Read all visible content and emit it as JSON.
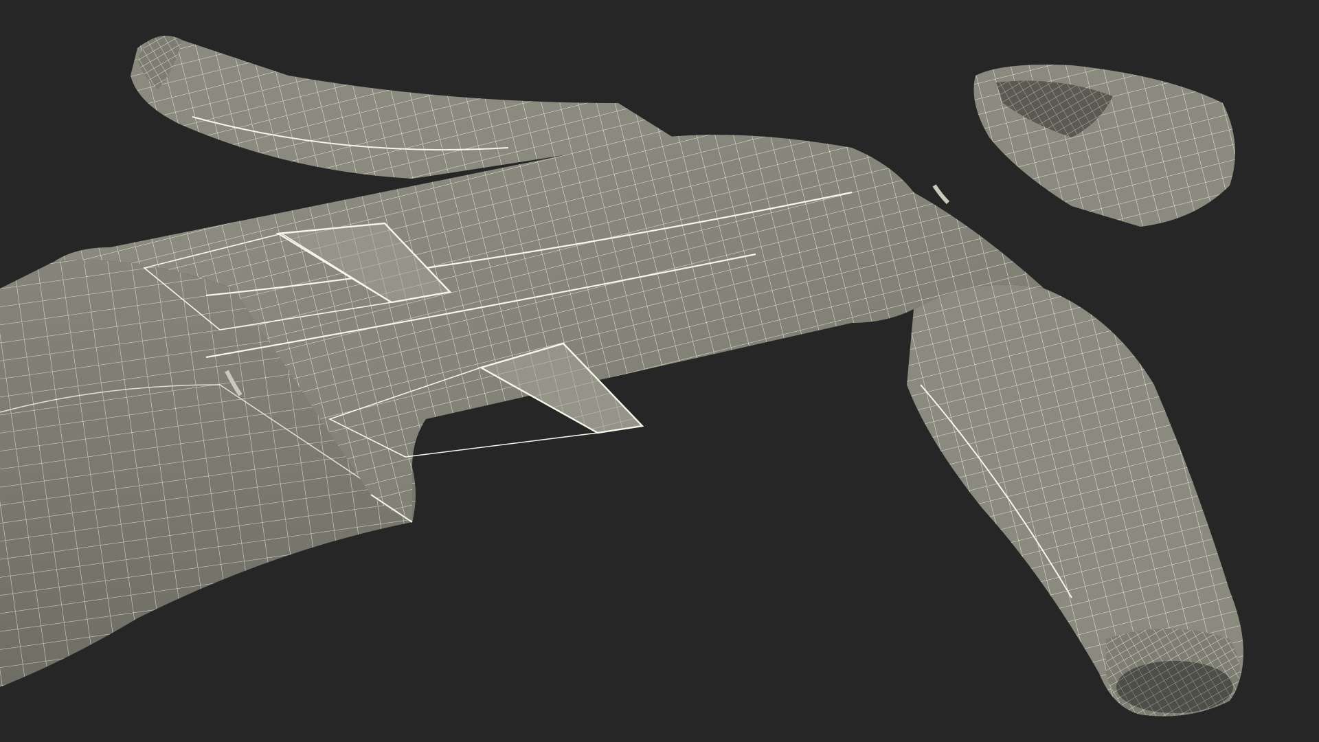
{
  "scene": {
    "subject": "hooded-jacket-wireframe-render",
    "colors": {
      "background": "#262626",
      "surface": "#8a8a7e",
      "surface_shadow": "#6f6f66",
      "surface_light": "#9a9a8e",
      "wire": "#efefe2",
      "seam": "#f6f6ea",
      "inner": "#5a5a53"
    },
    "parts": [
      {
        "id": "left-sleeve",
        "label": ""
      },
      {
        "id": "right-sleeve",
        "label": ""
      },
      {
        "id": "hood",
        "label": ""
      },
      {
        "id": "body",
        "label": ""
      },
      {
        "id": "lower-panel",
        "label": ""
      },
      {
        "id": "pocket-flap-upper",
        "label": ""
      },
      {
        "id": "pocket-flap-lower",
        "label": ""
      },
      {
        "id": "cuff-opening",
        "label": ""
      }
    ]
  }
}
